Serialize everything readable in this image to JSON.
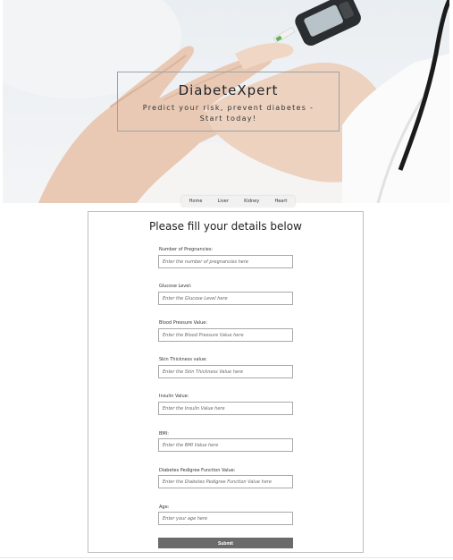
{
  "hero": {
    "title": "DiabeteXpert",
    "subtitle": "Predict your risk, prevent diabetes - Start today!"
  },
  "nav": {
    "items": [
      "Home",
      "Liver",
      "Kidney",
      "Heart"
    ]
  },
  "form": {
    "title": "Please fill your details below",
    "fields": [
      {
        "label": "Number of Pregnancies:",
        "placeholder": "Enter the number of pregnancies here"
      },
      {
        "label": "Glucose Level:",
        "placeholder": "Enter the Glucose Level here"
      },
      {
        "label": "Blood Pressure Value:",
        "placeholder": "Enter the Blood Pressure Value here"
      },
      {
        "label": "Skin Thickness value:",
        "placeholder": "Enter the Skin Thickness Value here"
      },
      {
        "label": "Insulin Value:",
        "placeholder": "Enter the Insulin Value here"
      },
      {
        "label": "BMI:",
        "placeholder": "Enter the BMI Value here"
      },
      {
        "label": "Diabetes Pedigree Function Value:",
        "placeholder": "Enter the Diabetes Pedigree Function Value here"
      },
      {
        "label": "Age:",
        "placeholder": "Enter your age here"
      }
    ],
    "submit_label": "Submit"
  }
}
